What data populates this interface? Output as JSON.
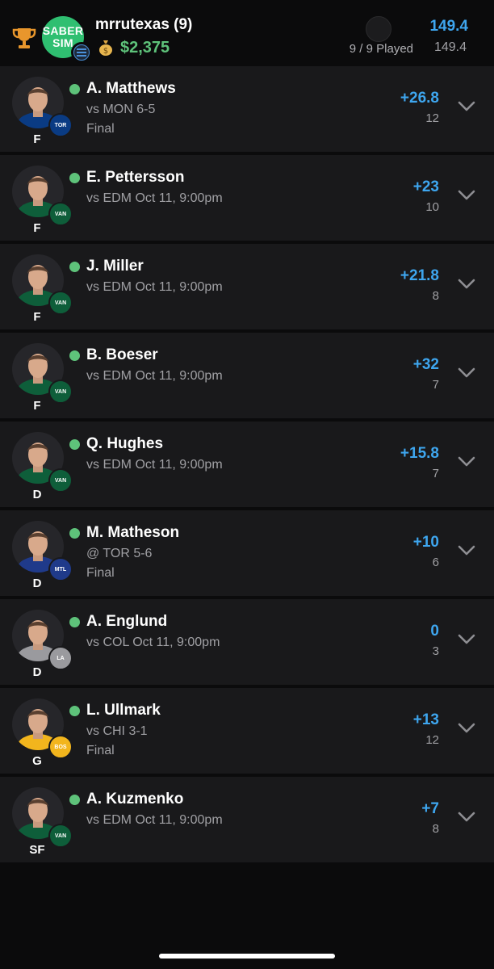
{
  "header": {
    "logo_line1": "SABER",
    "logo_line2": "SIM",
    "username": "mrrutexas (9)",
    "balance": "$2,375",
    "played": "9 / 9 Played",
    "total_projection": "149.4",
    "total_actual": "149.4"
  },
  "colors": {
    "accent_blue": "#3ea6ef",
    "money_green": "#5ec27a",
    "trophy_gold": "#e8962c",
    "row_bg": "#19191b",
    "page_bg": "#0b0b0c"
  },
  "icons": {
    "trophy": "trophy-icon",
    "money": "money-bag-icon",
    "expand": "chevron-down-icon"
  },
  "players": [
    {
      "name": "A. Matthews",
      "game": "vs MON 6-5",
      "result": "Final",
      "projection": "+26.8",
      "ownership": "12",
      "position": "F",
      "team_color": "#0a3b83",
      "team_mark": "TOR"
    },
    {
      "name": "E. Pettersson",
      "game": "vs EDM Oct 11, 9:00pm",
      "result": "",
      "projection": "+23",
      "ownership": "10",
      "position": "F",
      "team_color": "#0e5e3a",
      "team_mark": "VAN"
    },
    {
      "name": "J. Miller",
      "game": "vs EDM Oct 11, 9:00pm",
      "result": "",
      "projection": "+21.8",
      "ownership": "8",
      "position": "F",
      "team_color": "#0e5e3a",
      "team_mark": "VAN"
    },
    {
      "name": "B. Boeser",
      "game": "vs EDM Oct 11, 9:00pm",
      "result": "",
      "projection": "+32",
      "ownership": "7",
      "position": "F",
      "team_color": "#0e5e3a",
      "team_mark": "VAN"
    },
    {
      "name": "Q. Hughes",
      "game": "vs EDM Oct 11, 9:00pm",
      "result": "",
      "projection": "+15.8",
      "ownership": "7",
      "position": "D",
      "team_color": "#0e5e3a",
      "team_mark": "VAN"
    },
    {
      "name": "M. Matheson",
      "game": "@ TOR 5-6",
      "result": "Final",
      "projection": "+10",
      "ownership": "6",
      "position": "D",
      "team_color": "#1f3a8a",
      "team_mark": "MTL"
    },
    {
      "name": "A. Englund",
      "game": "vs COL Oct 11, 9:00pm",
      "result": "",
      "projection": "0",
      "ownership": "3",
      "position": "D",
      "team_color": "#9a9a9e",
      "team_mark": "LA"
    },
    {
      "name": "L. Ullmark",
      "game": "vs CHI 3-1",
      "result": "Final",
      "projection": "+13",
      "ownership": "12",
      "position": "G",
      "team_color": "#f2b51d",
      "team_mark": "BOS"
    },
    {
      "name": "A. Kuzmenko",
      "game": "vs EDM Oct 11, 9:00pm",
      "result": "",
      "projection": "+7",
      "ownership": "8",
      "position": "SF",
      "team_color": "#0e5e3a",
      "team_mark": "VAN"
    }
  ]
}
